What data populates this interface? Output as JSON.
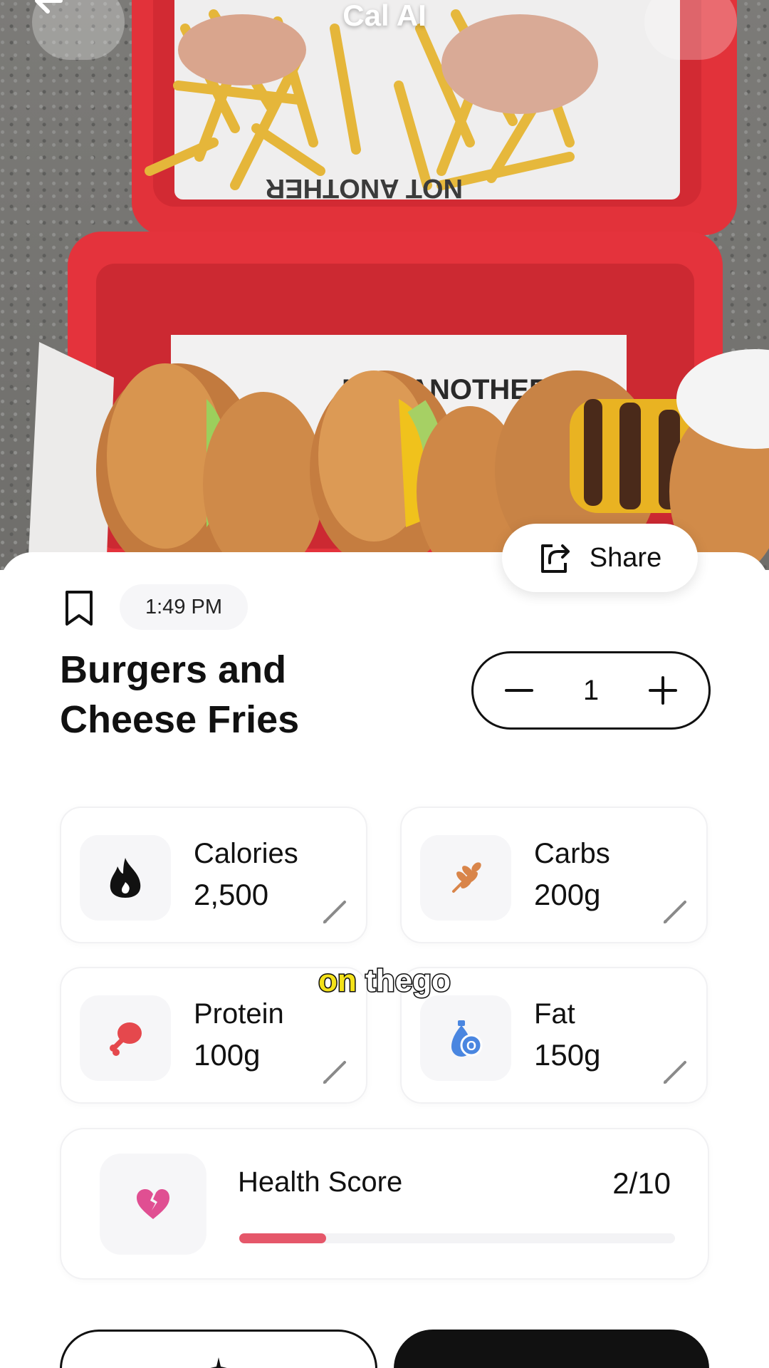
{
  "header": {
    "title": "Cal AI",
    "back_icon": "arrow-left-icon",
    "more_icon": "more-dots-icon"
  },
  "photo": {
    "description_icon": "food-photo"
  },
  "share": {
    "label": "Share",
    "icon": "share-icon"
  },
  "meal": {
    "time": "1:49 PM",
    "title": "Burgers and Cheese Fries",
    "quantity": "1",
    "bookmark_icon": "bookmark-icon"
  },
  "nutrients": {
    "calories": {
      "label": "Calories",
      "value": "2,500",
      "icon": "flame-icon"
    },
    "carbs": {
      "label": "Carbs",
      "value": "200g",
      "icon": "wheat-icon"
    },
    "protein": {
      "label": "Protein",
      "value": "100g",
      "icon": "drumstick-icon"
    },
    "fat": {
      "label": "Fat",
      "value": "150g",
      "icon": "oil-drop-icon"
    }
  },
  "health": {
    "label": "Health Score",
    "score": "2/10",
    "fraction": 0.2,
    "icon": "broken-heart-icon",
    "bar_color": "#e5576a"
  },
  "caption": {
    "words": [
      "on",
      "the",
      "go"
    ]
  },
  "colors": {
    "accent_dark": "#111111",
    "card_bg": "#ffffff",
    "tray_red": "#e8303a"
  }
}
